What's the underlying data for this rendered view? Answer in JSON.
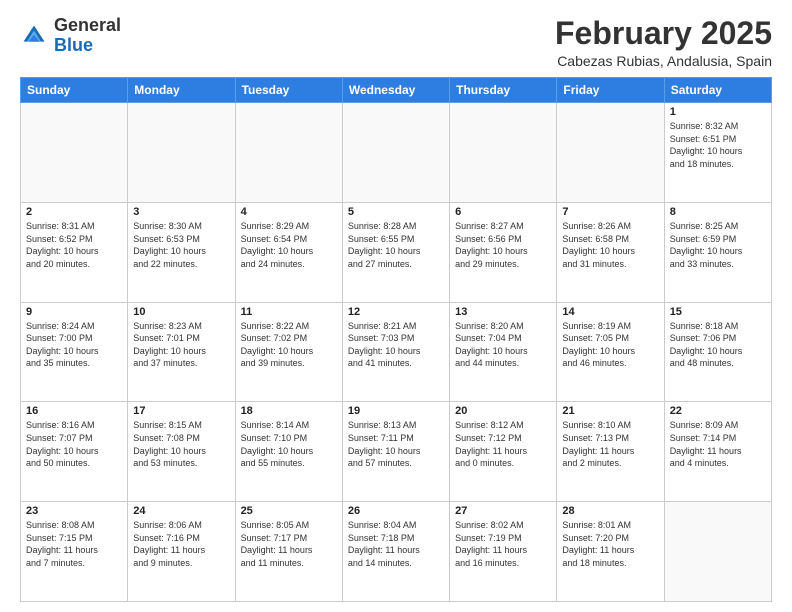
{
  "header": {
    "logo_general": "General",
    "logo_blue": "Blue",
    "month_title": "February 2025",
    "location": "Cabezas Rubias, Andalusia, Spain"
  },
  "days_of_week": [
    "Sunday",
    "Monday",
    "Tuesday",
    "Wednesday",
    "Thursday",
    "Friday",
    "Saturday"
  ],
  "weeks": [
    [
      {
        "num": "",
        "info": ""
      },
      {
        "num": "",
        "info": ""
      },
      {
        "num": "",
        "info": ""
      },
      {
        "num": "",
        "info": ""
      },
      {
        "num": "",
        "info": ""
      },
      {
        "num": "",
        "info": ""
      },
      {
        "num": "1",
        "info": "Sunrise: 8:32 AM\nSunset: 6:51 PM\nDaylight: 10 hours\nand 18 minutes."
      }
    ],
    [
      {
        "num": "2",
        "info": "Sunrise: 8:31 AM\nSunset: 6:52 PM\nDaylight: 10 hours\nand 20 minutes."
      },
      {
        "num": "3",
        "info": "Sunrise: 8:30 AM\nSunset: 6:53 PM\nDaylight: 10 hours\nand 22 minutes."
      },
      {
        "num": "4",
        "info": "Sunrise: 8:29 AM\nSunset: 6:54 PM\nDaylight: 10 hours\nand 24 minutes."
      },
      {
        "num": "5",
        "info": "Sunrise: 8:28 AM\nSunset: 6:55 PM\nDaylight: 10 hours\nand 27 minutes."
      },
      {
        "num": "6",
        "info": "Sunrise: 8:27 AM\nSunset: 6:56 PM\nDaylight: 10 hours\nand 29 minutes."
      },
      {
        "num": "7",
        "info": "Sunrise: 8:26 AM\nSunset: 6:58 PM\nDaylight: 10 hours\nand 31 minutes."
      },
      {
        "num": "8",
        "info": "Sunrise: 8:25 AM\nSunset: 6:59 PM\nDaylight: 10 hours\nand 33 minutes."
      }
    ],
    [
      {
        "num": "9",
        "info": "Sunrise: 8:24 AM\nSunset: 7:00 PM\nDaylight: 10 hours\nand 35 minutes."
      },
      {
        "num": "10",
        "info": "Sunrise: 8:23 AM\nSunset: 7:01 PM\nDaylight: 10 hours\nand 37 minutes."
      },
      {
        "num": "11",
        "info": "Sunrise: 8:22 AM\nSunset: 7:02 PM\nDaylight: 10 hours\nand 39 minutes."
      },
      {
        "num": "12",
        "info": "Sunrise: 8:21 AM\nSunset: 7:03 PM\nDaylight: 10 hours\nand 41 minutes."
      },
      {
        "num": "13",
        "info": "Sunrise: 8:20 AM\nSunset: 7:04 PM\nDaylight: 10 hours\nand 44 minutes."
      },
      {
        "num": "14",
        "info": "Sunrise: 8:19 AM\nSunset: 7:05 PM\nDaylight: 10 hours\nand 46 minutes."
      },
      {
        "num": "15",
        "info": "Sunrise: 8:18 AM\nSunset: 7:06 PM\nDaylight: 10 hours\nand 48 minutes."
      }
    ],
    [
      {
        "num": "16",
        "info": "Sunrise: 8:16 AM\nSunset: 7:07 PM\nDaylight: 10 hours\nand 50 minutes."
      },
      {
        "num": "17",
        "info": "Sunrise: 8:15 AM\nSunset: 7:08 PM\nDaylight: 10 hours\nand 53 minutes."
      },
      {
        "num": "18",
        "info": "Sunrise: 8:14 AM\nSunset: 7:10 PM\nDaylight: 10 hours\nand 55 minutes."
      },
      {
        "num": "19",
        "info": "Sunrise: 8:13 AM\nSunset: 7:11 PM\nDaylight: 10 hours\nand 57 minutes."
      },
      {
        "num": "20",
        "info": "Sunrise: 8:12 AM\nSunset: 7:12 PM\nDaylight: 11 hours\nand 0 minutes."
      },
      {
        "num": "21",
        "info": "Sunrise: 8:10 AM\nSunset: 7:13 PM\nDaylight: 11 hours\nand 2 minutes."
      },
      {
        "num": "22",
        "info": "Sunrise: 8:09 AM\nSunset: 7:14 PM\nDaylight: 11 hours\nand 4 minutes."
      }
    ],
    [
      {
        "num": "23",
        "info": "Sunrise: 8:08 AM\nSunset: 7:15 PM\nDaylight: 11 hours\nand 7 minutes."
      },
      {
        "num": "24",
        "info": "Sunrise: 8:06 AM\nSunset: 7:16 PM\nDaylight: 11 hours\nand 9 minutes."
      },
      {
        "num": "25",
        "info": "Sunrise: 8:05 AM\nSunset: 7:17 PM\nDaylight: 11 hours\nand 11 minutes."
      },
      {
        "num": "26",
        "info": "Sunrise: 8:04 AM\nSunset: 7:18 PM\nDaylight: 11 hours\nand 14 minutes."
      },
      {
        "num": "27",
        "info": "Sunrise: 8:02 AM\nSunset: 7:19 PM\nDaylight: 11 hours\nand 16 minutes."
      },
      {
        "num": "28",
        "info": "Sunrise: 8:01 AM\nSunset: 7:20 PM\nDaylight: 11 hours\nand 18 minutes."
      },
      {
        "num": "",
        "info": ""
      }
    ]
  ]
}
